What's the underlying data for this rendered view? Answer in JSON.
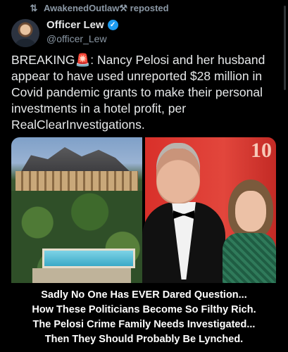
{
  "repost": {
    "icon": "repost-icon",
    "text": "AwakenedOutlaw⚒ reposted"
  },
  "author": {
    "name": "Officer Lew",
    "handle": "@officer_Lew",
    "verified": true,
    "verified_color": "#1d9bf0"
  },
  "post": {
    "breaking": "BREAKING",
    "siren": "🚨",
    "body": ": Nancy Pelosi and her husband appear to have used unreported $28 million in Covid pandemic grants to make their personal investments in a hotel profit, per RealClearInvestigations."
  },
  "media": {
    "left_image": "resort-aerial-photo",
    "right_image": "couple-event-photo",
    "right_bg_text": "10"
  },
  "caption": {
    "lines": [
      "Sadly No One Has EVER Dared Question...",
      "How These Politicians Become So Filthy Rich.",
      "The Pelosi Crime Family Needs Investigated...",
      "Then They Should Probably Be Lynched."
    ]
  }
}
